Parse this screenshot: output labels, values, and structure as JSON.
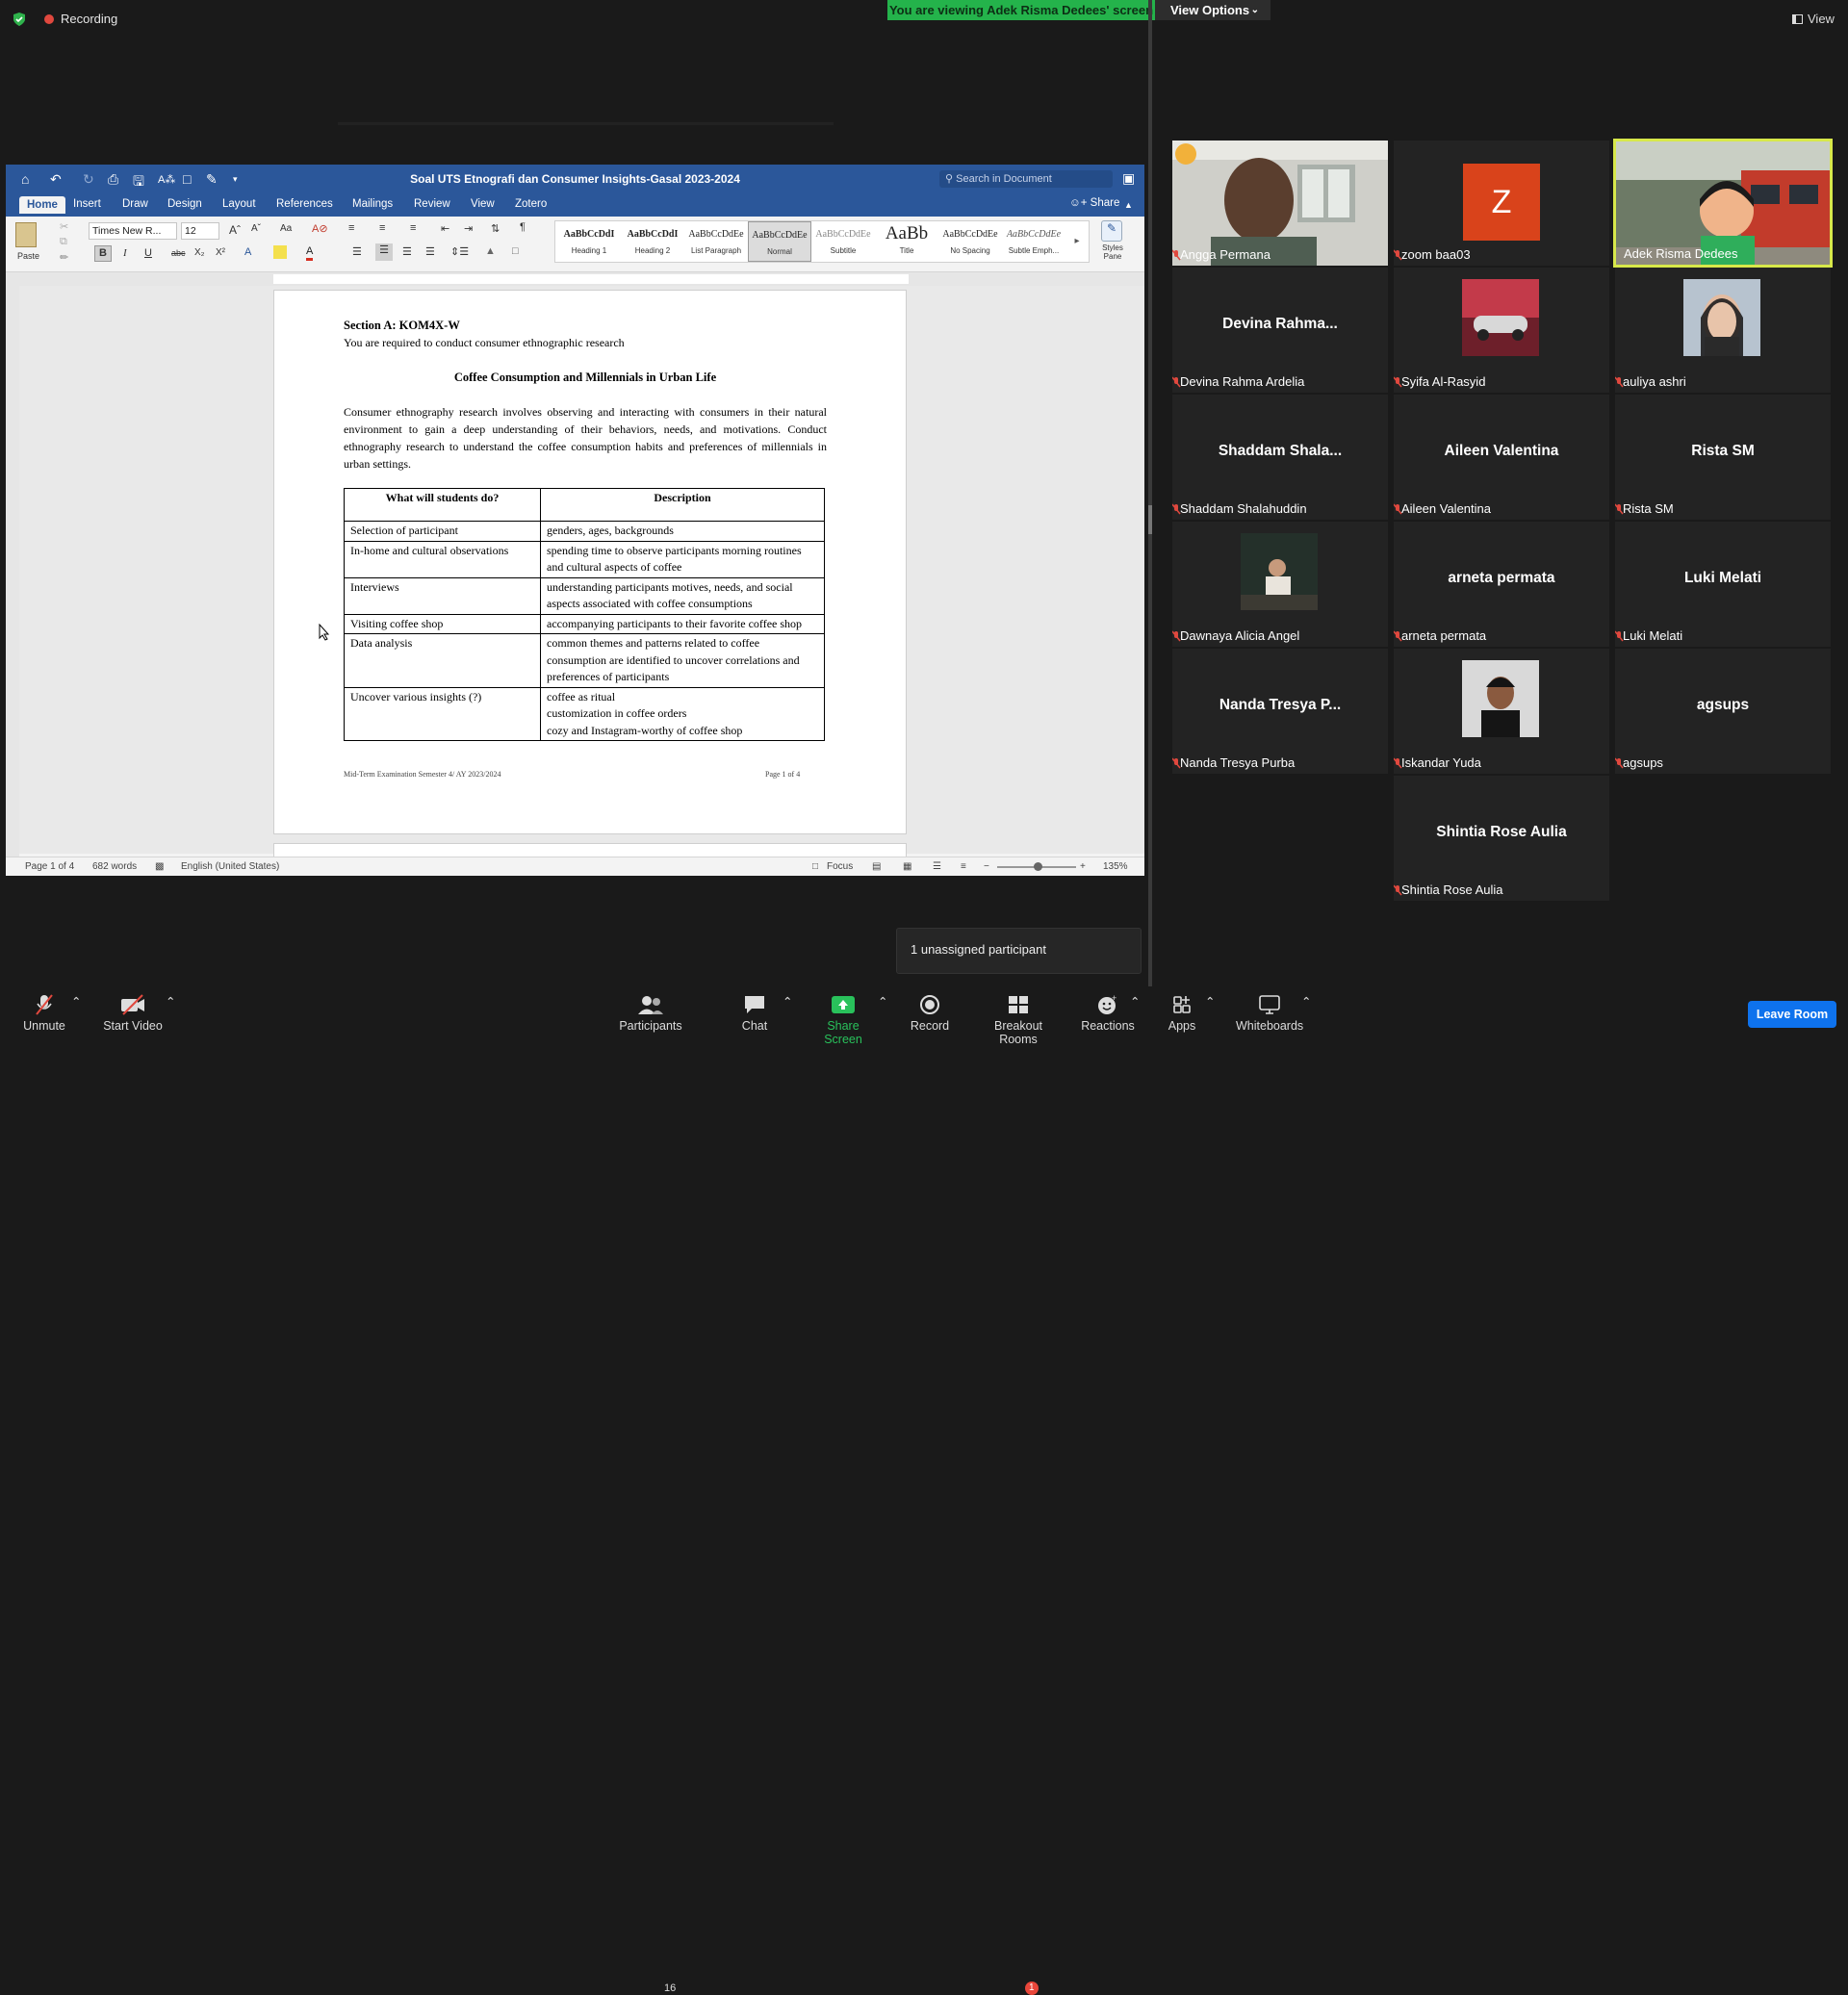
{
  "top": {
    "recording_label": "Recording",
    "viewing_banner": "You are viewing Adek Risma Dedees' screen",
    "view_options": "View Options",
    "view_label": "View"
  },
  "word": {
    "doc_title": "Soal UTS Etnografi dan Consumer Insights-Gasal 2023-2024",
    "search_placeholder": "Search in Document",
    "tabs": [
      "Home",
      "Insert",
      "Draw",
      "Design",
      "Layout",
      "References",
      "Mailings",
      "Review",
      "View",
      "Zotero"
    ],
    "share": "Share",
    "paste": "Paste",
    "font_name": "Times New R...",
    "font_size": "12",
    "styles": [
      {
        "preview": "AaBbCcDdI",
        "name": "Heading 1"
      },
      {
        "preview": "AaBbCcDdI",
        "name": "Heading 2"
      },
      {
        "preview": "AaBbCcDdEe",
        "name": "List Paragraph"
      },
      {
        "preview": "AaBbCcDdEe",
        "name": "Normal"
      },
      {
        "preview": "AaBbCcDdEe",
        "name": "Subtitle"
      },
      {
        "preview": "AaBb",
        "name": "Title"
      },
      {
        "preview": "AaBbCcDdEe",
        "name": "No Spacing"
      },
      {
        "preview": "AaBbCcDdEe",
        "name": "Subtle Emph..."
      }
    ],
    "styles_pane": "Styles Pane",
    "status": {
      "page": "Page 1 of 4",
      "words": "682 words",
      "language": "English (United States)",
      "focus": "Focus",
      "zoom": "135%"
    }
  },
  "document": {
    "section": "Section A: KOM4X-W",
    "section_sub": "You are required to conduct consumer ethnographic research",
    "heading": "Coffee Consumption and Millennials in Urban Life",
    "paragraph": "Consumer ethnography research involves observing and interacting with consumers in their natural environment to gain a deep understanding of their behaviors, needs, and motivations. Conduct ethnography research to understand the coffee consumption habits and preferences of millennials in urban settings.",
    "table_headers": [
      "What will students do?",
      "Description"
    ],
    "table_rows": [
      [
        "Selection of participant",
        "genders, ages, backgrounds"
      ],
      [
        "In-home and cultural observations",
        "spending time to observe participants morning routines and cultural aspects of coffee"
      ],
      [
        "Interviews",
        "understanding participants motives, needs, and social aspects associated with coffee consumptions"
      ],
      [
        "Visiting coffee shop",
        "accompanying participants to their favorite coffee shop"
      ],
      [
        "Data analysis",
        "common themes and patterns related to coffee consumption are identified to uncover correlations and preferences of participants"
      ],
      [
        "Uncover various insights (?)",
        "coffee as ritual\ncustomization in coffee orders\ncozy and Instagram-worthy of coffee shop"
      ]
    ],
    "footer_left": "Mid-Term Examination Semester 4/ AY 2023/2024",
    "footer_right": "Page 1 of 4"
  },
  "participants": [
    {
      "name": "Angga Permana",
      "kind": "video"
    },
    {
      "name": "zoom baa03",
      "kind": "letter",
      "letter": "Z"
    },
    {
      "name": "Adek Risma Dedees",
      "kind": "video",
      "active": true
    },
    {
      "name": "Devina Rahma Ardelia",
      "kind": "text",
      "short": "Devina  Rahma..."
    },
    {
      "name": "Syifa Al-Rasyid",
      "kind": "photo"
    },
    {
      "name": "auliya ashri",
      "kind": "photo"
    },
    {
      "name": "Shaddam Shalahuddin",
      "kind": "text",
      "short": "Shaddam  Shala..."
    },
    {
      "name": "Aileen Valentina",
      "kind": "text",
      "short": "Aileen Valentina"
    },
    {
      "name": "Rista SM",
      "kind": "text",
      "short": "Rista SM"
    },
    {
      "name": "Dawnaya Alicia Angel",
      "kind": "photo"
    },
    {
      "name": "arneta permata",
      "kind": "text",
      "short": "arneta permata"
    },
    {
      "name": "Luki Melati",
      "kind": "text",
      "short": "Luki Melati"
    },
    {
      "name": "Nanda Tresya Purba",
      "kind": "text",
      "short": "Nanda Tresya P..."
    },
    {
      "name": "Iskandar Yuda",
      "kind": "photo"
    },
    {
      "name": "agsups",
      "kind": "text",
      "short": "agsups"
    },
    {
      "name": "Shintia Rose Aulia",
      "kind": "text",
      "short": "Shintia Rose Aulia"
    }
  ],
  "toast": "1 unassigned participant",
  "toolbar": {
    "unmute": "Unmute",
    "start_video": "Start Video",
    "participants": "Participants",
    "participants_count": "16",
    "chat": "Chat",
    "share_screen": "Share Screen",
    "record": "Record",
    "breakout_rooms": "Breakout Rooms",
    "breakout_badge": "1",
    "reactions": "Reactions",
    "apps": "Apps",
    "whiteboards": "Whiteboards",
    "leave_room": "Leave Room"
  },
  "colors": {
    "word_blue": "#2b579a",
    "banner_green": "#24b34b",
    "leave_blue": "#0e72ed",
    "mute_red": "#e0483e",
    "active_border": "#d7e84a"
  }
}
